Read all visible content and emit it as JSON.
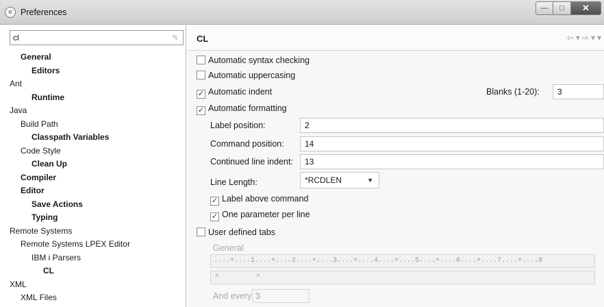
{
  "window": {
    "title": "Preferences",
    "app_icon": "eclipse-icon",
    "min_glyph": "—",
    "max_glyph": "□",
    "close_glyph": "✕"
  },
  "filter": {
    "value": "cl",
    "clear_icon": "✎"
  },
  "tree": [
    {
      "label": "General",
      "indent": 1,
      "bold": true
    },
    {
      "label": "Editors",
      "indent": 2,
      "bold": true
    },
    {
      "label": "Ant",
      "indent": 0,
      "bold": false
    },
    {
      "label": "Runtime",
      "indent": 2,
      "bold": true
    },
    {
      "label": "Java",
      "indent": 0,
      "bold": false
    },
    {
      "label": "Build Path",
      "indent": 1,
      "bold": false
    },
    {
      "label": "Classpath Variables",
      "indent": 2,
      "bold": true
    },
    {
      "label": "Code Style",
      "indent": 1,
      "bold": false
    },
    {
      "label": "Clean Up",
      "indent": 2,
      "bold": true
    },
    {
      "label": "Compiler",
      "indent": 1,
      "bold": true
    },
    {
      "label": "Editor",
      "indent": 1,
      "bold": true
    },
    {
      "label": "Save Actions",
      "indent": 2,
      "bold": true
    },
    {
      "label": "Typing",
      "indent": 2,
      "bold": true
    },
    {
      "label": "Remote Systems",
      "indent": 0,
      "bold": false
    },
    {
      "label": "Remote Systems LPEX Editor",
      "indent": 1,
      "bold": false
    },
    {
      "label": "IBM i Parsers",
      "indent": 2,
      "bold": false
    },
    {
      "label": "CL",
      "indent": 3,
      "bold": true
    },
    {
      "label": "XML",
      "indent": 0,
      "bold": false
    },
    {
      "label": "XML Files",
      "indent": 1,
      "bold": false
    }
  ],
  "page": {
    "title": "CL",
    "nav": {
      "back": "⇦",
      "back_menu": "▾",
      "forward": "⇨",
      "forward_menu": "▾",
      "view_menu": "▾"
    }
  },
  "options": {
    "syntax_checking": {
      "label": "Automatic syntax checking",
      "checked": false
    },
    "uppercasing": {
      "label": "Automatic uppercasing",
      "checked": false
    },
    "indent": {
      "label": "Automatic indent",
      "checked": true
    },
    "blanks_label": "Blanks (1-20):",
    "blanks_value": "3",
    "formatting": {
      "label": "Automatic formatting",
      "checked": true
    },
    "label_position_label": "Label position:",
    "label_position_value": "2",
    "command_position_label": "Command position:",
    "command_position_value": "14",
    "continued_indent_label": "Continued line indent:",
    "continued_indent_value": "13",
    "line_length_label": "Line Length:",
    "line_length_value": "*RCDLEN",
    "label_above": {
      "label": "Label above command",
      "checked": true
    },
    "one_param": {
      "label": "One parameter per line",
      "checked": true
    },
    "user_tabs": {
      "label": "User defined tabs",
      "checked": false
    },
    "general_label": "General",
    "ruler": "....+....1....+....2....+....3....+....4....+....5....+....6....+....7....+....8",
    "tab_markers": "^         ^",
    "and_every_label": "And every:",
    "and_every_value": "3"
  }
}
